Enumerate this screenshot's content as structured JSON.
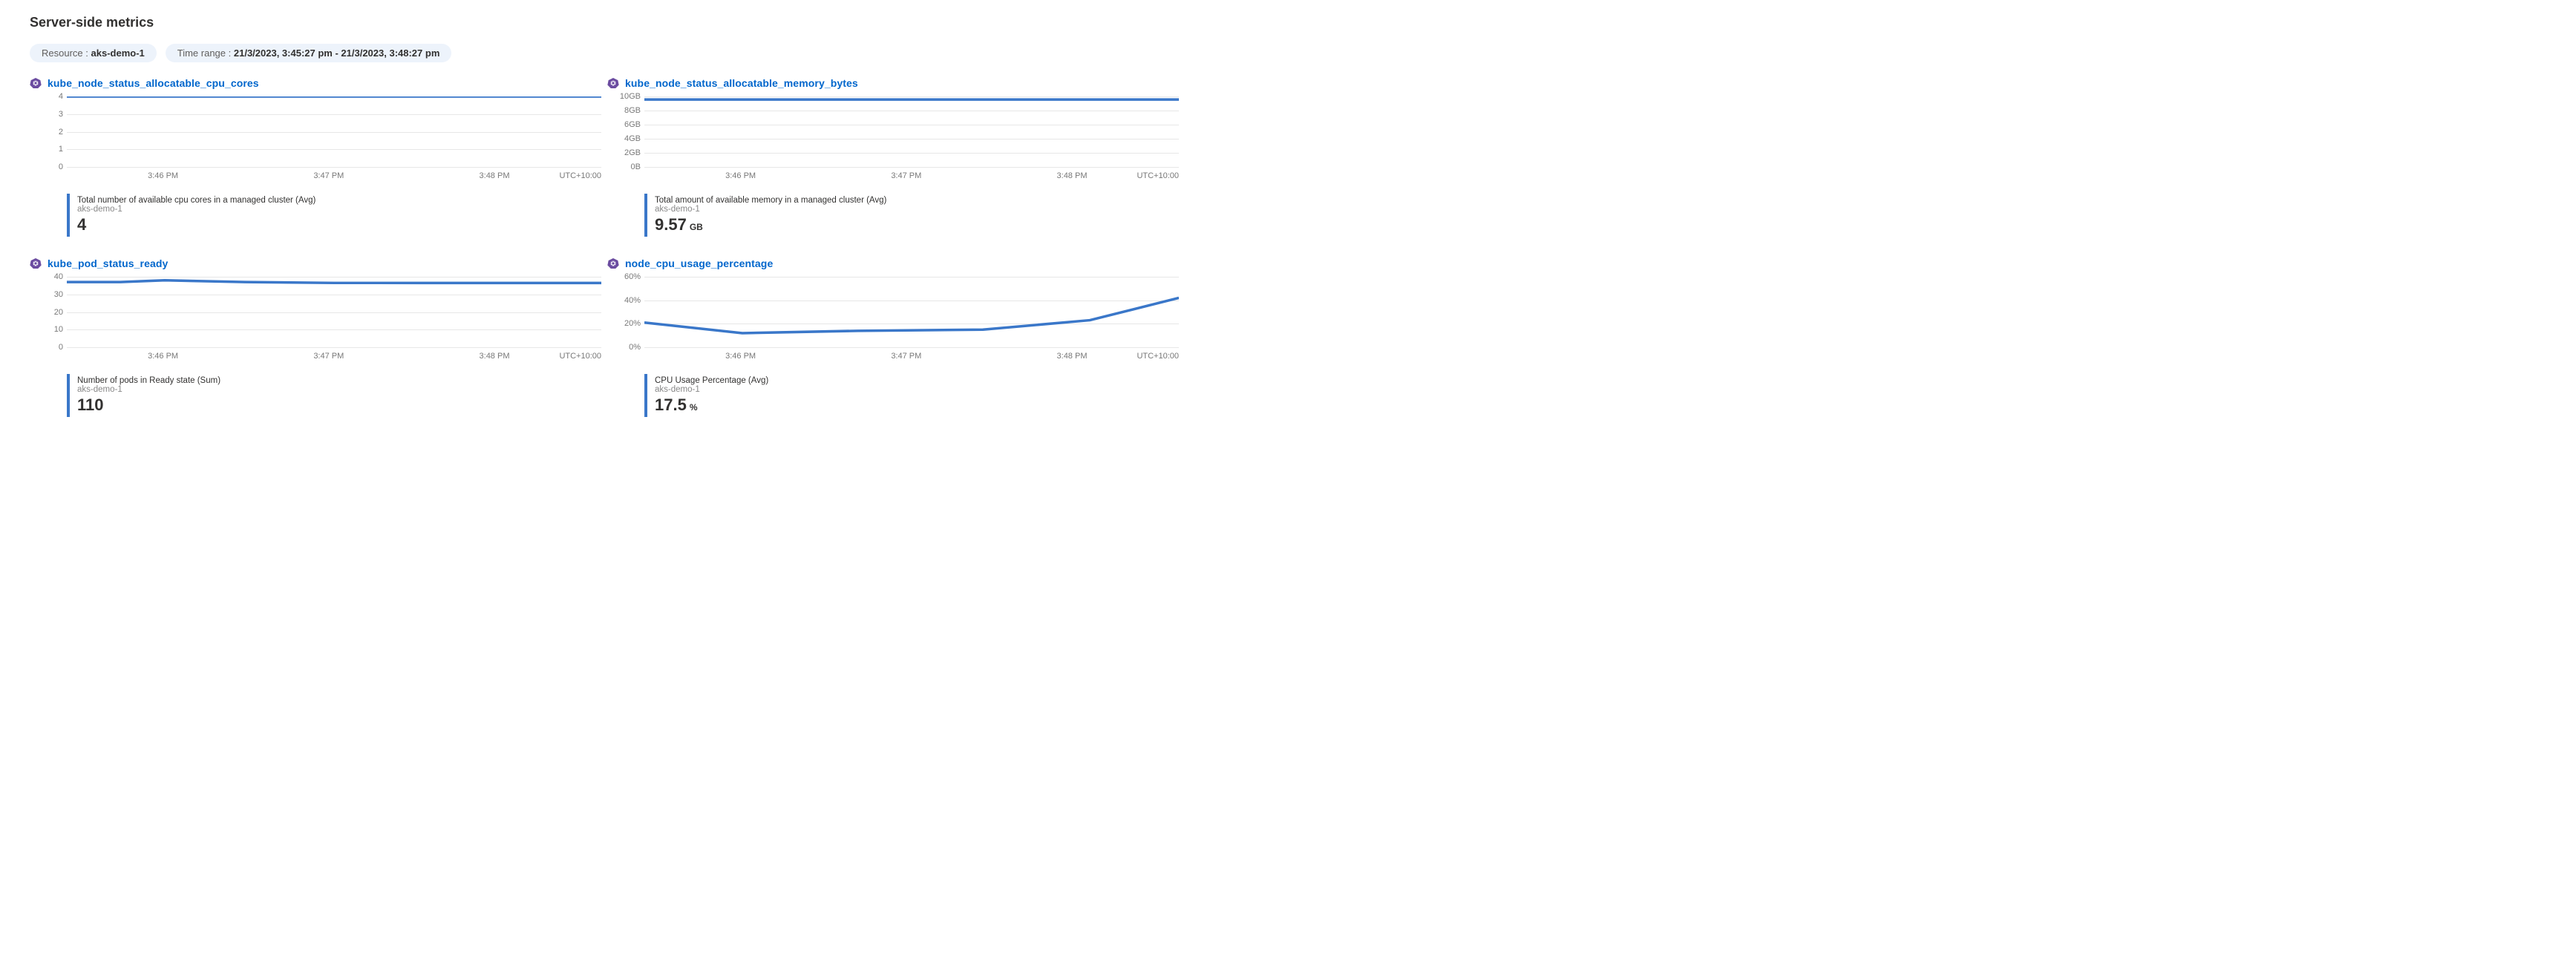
{
  "header": {
    "title": "Server-side metrics",
    "resource_label": "Resource :",
    "resource_value": "aks-demo-1",
    "timerange_label": "Time range :",
    "timerange_value": "21/3/2023, 3:45:27 pm - 21/3/2023, 3:48:27 pm"
  },
  "timezone": "UTC+10:00",
  "x_ticks": [
    "3:46 PM",
    "3:47 PM",
    "3:48 PM"
  ],
  "charts": [
    {
      "id": "cpu_cores",
      "title": "kube_node_status_allocatable_cpu_cores",
      "y_ticks": [
        "0",
        "1",
        "2",
        "3",
        "4"
      ],
      "summary": {
        "desc": "Total number of available cpu cores in a managed cluster (Avg)",
        "sub": "aks-demo-1",
        "value": "4",
        "unit": ""
      }
    },
    {
      "id": "mem_bytes",
      "title": "kube_node_status_allocatable_memory_bytes",
      "y_ticks": [
        "0B",
        "2GB",
        "4GB",
        "6GB",
        "8GB",
        "10GB"
      ],
      "summary": {
        "desc": "Total amount of available memory in a managed cluster (Avg)",
        "sub": "aks-demo-1",
        "value": "9.57",
        "unit": "GB"
      }
    },
    {
      "id": "pod_ready",
      "title": "kube_pod_status_ready",
      "y_ticks": [
        "0",
        "10",
        "20",
        "30",
        "40"
      ],
      "summary": {
        "desc": "Number of pods in Ready state (Sum)",
        "sub": "aks-demo-1",
        "value": "110",
        "unit": ""
      }
    },
    {
      "id": "cpu_pct",
      "title": "node_cpu_usage_percentage",
      "y_ticks": [
        "0%",
        "20%",
        "40%",
        "60%"
      ],
      "summary": {
        "desc": "CPU Usage Percentage (Avg)",
        "sub": "aks-demo-1",
        "value": "17.5",
        "unit": "%"
      }
    }
  ],
  "chart_data": [
    {
      "id": "cpu_cores",
      "type": "line",
      "title": "kube_node_status_allocatable_cpu_cores",
      "xlabel": "",
      "ylabel": "",
      "ylim": [
        0,
        4
      ],
      "x": [
        0,
        0.5,
        1.0,
        1.5,
        2.0,
        2.5,
        3.0
      ],
      "series": [
        {
          "name": "aks-demo-1",
          "values": [
            4,
            4,
            4,
            4,
            4,
            4,
            4
          ]
        }
      ]
    },
    {
      "id": "mem_bytes",
      "type": "line",
      "title": "kube_node_status_allocatable_memory_bytes",
      "xlabel": "",
      "ylabel": "",
      "ylim": [
        0,
        10
      ],
      "x": [
        0,
        0.5,
        1.0,
        1.5,
        2.0,
        2.5,
        3.0
      ],
      "series": [
        {
          "name": "aks-demo-1",
          "values": [
            9.57,
            9.57,
            9.57,
            9.57,
            9.57,
            9.57,
            9.57
          ]
        }
      ]
    },
    {
      "id": "pod_ready",
      "type": "line",
      "title": "kube_pod_status_ready",
      "xlabel": "",
      "ylabel": "",
      "ylim": [
        0,
        40
      ],
      "x": [
        0,
        0.3,
        0.55,
        1.0,
        1.5,
        2.0,
        2.5,
        3.0
      ],
      "series": [
        {
          "name": "aks-demo-1",
          "values": [
            37,
            37,
            38,
            37,
            36.5,
            36.5,
            36.5,
            36.5
          ]
        }
      ]
    },
    {
      "id": "cpu_pct",
      "type": "line",
      "title": "node_cpu_usage_percentage",
      "xlabel": "",
      "ylabel": "",
      "ylim": [
        0,
        60
      ],
      "x": [
        0,
        0.55,
        1.2,
        1.9,
        2.5,
        3.0
      ],
      "series": [
        {
          "name": "aks-demo-1",
          "values": [
            21,
            12,
            14,
            15,
            23,
            42
          ]
        }
      ]
    }
  ]
}
